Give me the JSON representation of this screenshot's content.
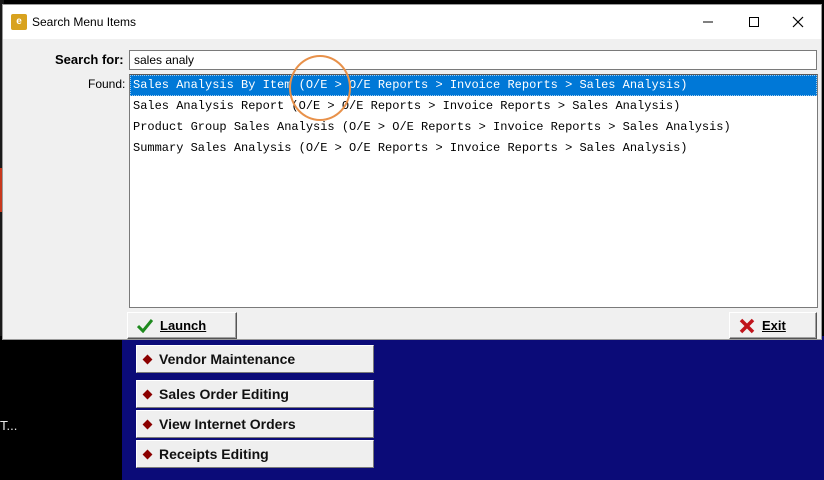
{
  "dialog": {
    "title": "Search Menu Items",
    "search_label": "Search for:",
    "search_value": "sales analy",
    "found_label": "Found:",
    "results": [
      "Sales Analysis By Item (O/E > O/E Reports > Invoice Reports > Sales Analysis)",
      "Sales Analysis Report (O/E > O/E Reports > Invoice Reports > Sales Analysis)",
      "Product Group Sales Analysis (O/E > O/E Reports > Invoice Reports > Sales Analysis)",
      "Summary Sales Analysis (O/E > O/E Reports > Invoice Reports > Sales Analysis)"
    ],
    "selected_index": 0,
    "launch_label": "Launch",
    "exit_label": "Exit",
    "icons": {
      "app": "app-icon",
      "minimize": "minimize-icon",
      "maximize": "maximize-icon",
      "close": "close-icon",
      "launch": "checkmark-icon",
      "exit": "x-icon"
    }
  },
  "background": {
    "menu_buttons": [
      "Vendor Maintenance",
      "Sales Order Editing",
      "View Internet Orders",
      "Receipts Editing"
    ],
    "truncated_text": "T...",
    "colors": {
      "navy": "#0b0b78",
      "selection": "#0078d7",
      "annotation_circle": "#e8914a"
    }
  }
}
